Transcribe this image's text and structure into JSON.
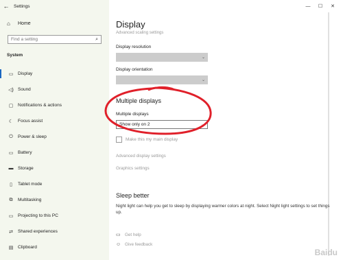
{
  "window": {
    "title": "Settings"
  },
  "sidebar": {
    "home_label": "Home",
    "search_placeholder": "Find a setting",
    "section_label": "System",
    "items": [
      {
        "label": "Display",
        "icon": "monitor-icon"
      },
      {
        "label": "Sound",
        "icon": "speaker-icon"
      },
      {
        "label": "Notifications & actions",
        "icon": "notification-icon"
      },
      {
        "label": "Focus assist",
        "icon": "moon-icon"
      },
      {
        "label": "Power & sleep",
        "icon": "power-icon"
      },
      {
        "label": "Battery",
        "icon": "battery-icon"
      },
      {
        "label": "Storage",
        "icon": "storage-icon"
      },
      {
        "label": "Tablet mode",
        "icon": "tablet-icon"
      },
      {
        "label": "Multitasking",
        "icon": "multitasking-icon"
      },
      {
        "label": "Projecting to this PC",
        "icon": "projector-icon"
      },
      {
        "label": "Shared experiences",
        "icon": "shared-icon"
      },
      {
        "label": "Clipboard",
        "icon": "clipboard-icon"
      }
    ]
  },
  "main": {
    "title": "Display",
    "advanced_scaling_link": "Advanced scaling settings",
    "resolution_label": "Display resolution",
    "resolution_value": "",
    "orientation_label": "Display orientation",
    "orientation_value": "",
    "multiple_displays_heading": "Multiple displays",
    "multiple_displays_label": "Multiple displays",
    "multiple_displays_value": "Show only on 2",
    "main_display_checkbox": "Make this my main display",
    "advanced_display_link": "Advanced display settings",
    "graphics_link": "Graphics settings",
    "sleep_heading": "Sleep better",
    "sleep_desc": "Night light can help you get to sleep by displaying warmer colors at night. Select Night light settings to set things up.",
    "get_help": "Get help",
    "give_feedback": "Give feedback"
  },
  "annotation_color": "#e0202a",
  "accent_color": "#1a66c0",
  "watermark": "Baidu"
}
